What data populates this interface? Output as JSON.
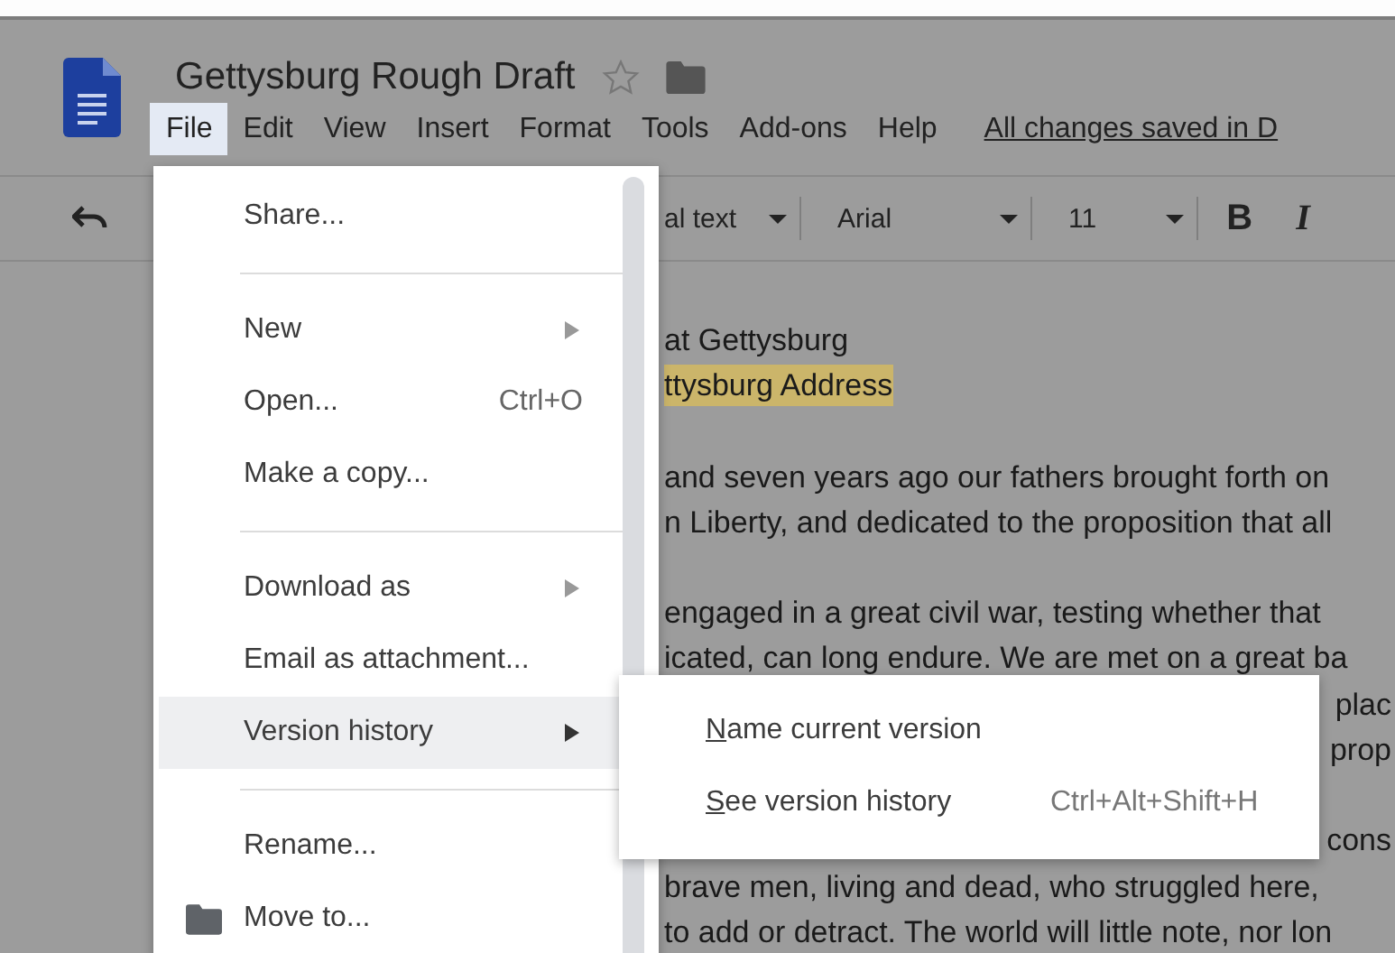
{
  "document": {
    "title": "Gettysburg Rough Draft",
    "starred": false,
    "save_status": "All changes saved in D"
  },
  "menu_bar": [
    {
      "label": "File",
      "selected": true
    },
    {
      "label": "Edit",
      "selected": false
    },
    {
      "label": "View",
      "selected": false
    },
    {
      "label": "Insert",
      "selected": false
    },
    {
      "label": "Format",
      "selected": false
    },
    {
      "label": "Tools",
      "selected": false
    },
    {
      "label": "Add-ons",
      "selected": false
    },
    {
      "label": "Help",
      "selected": false
    }
  ],
  "toolbar": {
    "paragraph_style": "al text",
    "font": "Arial",
    "font_size": "11",
    "format_buttons": [
      "B",
      "I"
    ]
  },
  "body": [
    {
      "lines": [
        {
          "text": "at Gettysburg",
          "kind": "full",
          "highlight": false
        },
        {
          "text": "ttysburg Address",
          "kind": "full",
          "highlight": true
        }
      ]
    },
    {
      "lines": [
        {
          "text": "and seven years ago our fathers brought forth on",
          "kind": "full",
          "highlight": false
        },
        {
          "text": "n Liberty, and dedicated to the proposition that all",
          "kind": "full",
          "highlight": false
        }
      ]
    },
    {
      "lines": [
        {
          "text": "engaged in a great civil war, testing whether that",
          "kind": "full",
          "highlight": false
        },
        {
          "text": "icated, can long endure. We are met on a great ba",
          "kind": "full",
          "highlight": false
        },
        {
          "text": "plac",
          "kind": "edge",
          "highlight": false
        },
        {
          "text": "prop",
          "kind": "edge",
          "highlight": false
        }
      ]
    },
    {
      "lines": [
        {
          "text": "cons",
          "kind": "edge",
          "highlight": false
        },
        {
          "text": "brave men, living and dead, who struggled here,",
          "kind": "full",
          "highlight": false
        },
        {
          "text": "to add or detract. The world will little note, nor lon",
          "kind": "full",
          "highlight": false
        }
      ]
    }
  ],
  "file_menu": {
    "groups": [
      [
        {
          "label": "Share...",
          "kind": "plain",
          "submenu": false,
          "selected": false
        }
      ],
      [
        {
          "label": "New",
          "kind": "plain",
          "submenu": true,
          "selected": false
        },
        {
          "label": "Open...",
          "kind": "plain",
          "shortcut": "Ctrl+O",
          "submenu": false,
          "selected": false
        },
        {
          "label": "Make a copy...",
          "kind": "plain",
          "submenu": false,
          "selected": false
        }
      ],
      [
        {
          "label": "Download as",
          "kind": "plain",
          "submenu": true,
          "selected": false
        },
        {
          "label": "Email as attachment...",
          "kind": "plain",
          "submenu": false,
          "selected": false
        },
        {
          "label": "Version history",
          "kind": "plain",
          "submenu": true,
          "selected": true
        }
      ],
      [
        {
          "label": "Rename...",
          "kind": "plain",
          "submenu": false,
          "selected": false
        },
        {
          "label": "Move to...",
          "kind": "folder",
          "submenu": false,
          "selected": false
        }
      ]
    ]
  },
  "version_submenu": [
    {
      "label": "Name current version",
      "mnemonic": true
    },
    {
      "label": "See version history",
      "shortcut": "Ctrl+Alt+Shift+H",
      "mnemonic": true
    }
  ]
}
